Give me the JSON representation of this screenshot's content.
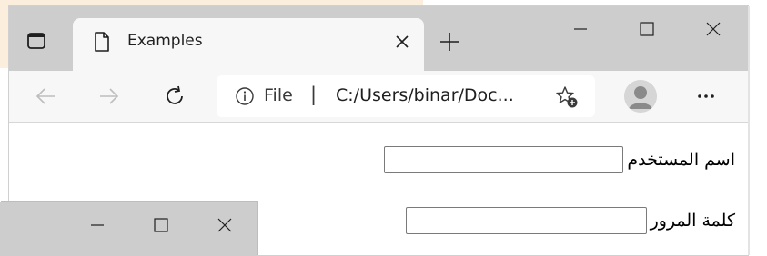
{
  "browser": {
    "tab": {
      "title": "Examples"
    },
    "address_bar": {
      "scheme_label": "File",
      "separator": "|",
      "url": "C:/Users/binar/Doc..."
    }
  },
  "form": {
    "username_label": "اسم المستخدم",
    "username_value": "",
    "password_label": "كلمة المرور",
    "password_value": ""
  },
  "icons": {
    "tab_actions": "tab-actions-icon",
    "page": "page-icon",
    "close_tab": "close-icon",
    "new_tab": "plus-icon",
    "minimize": "minimize-icon",
    "maximize": "maximize-icon",
    "close_window": "close-icon",
    "back": "back-arrow-icon",
    "forward": "forward-arrow-icon",
    "refresh": "refresh-icon",
    "info": "info-icon",
    "add_favorite": "star-plus-icon",
    "profile": "profile-icon",
    "more": "more-icon"
  },
  "colors": {
    "tabstrip": "#cdcdcd",
    "toolbar": "#f7f7f7",
    "background_tint": "#fbeedc"
  }
}
